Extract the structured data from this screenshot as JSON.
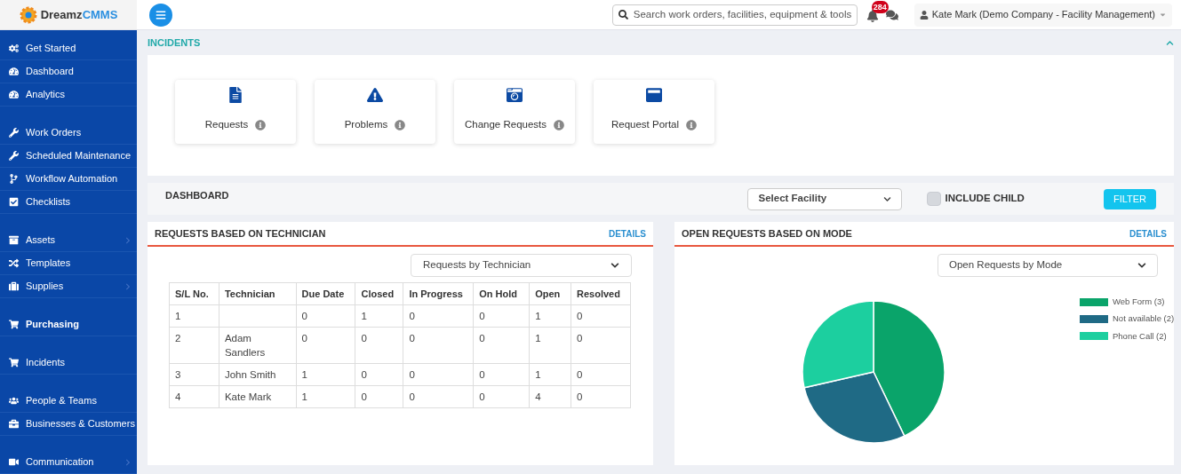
{
  "header": {
    "logo": {
      "word_1": "Dreamz",
      "word_2": "CMMS"
    },
    "search": {
      "placeholder": "Search work orders, facilities, equipment & tools"
    },
    "notifications_count": "284",
    "user": "Kate Mark (Demo Company - Facility Management)"
  },
  "sidebar": {
    "groups": [
      {
        "items": [
          {
            "label": "Get Started",
            "highlighted": false,
            "has_submenu": false
          },
          {
            "label": "Dashboard",
            "highlighted": false,
            "has_submenu": false
          },
          {
            "label": "Analytics",
            "highlighted": false,
            "has_submenu": false
          }
        ]
      },
      {
        "items": [
          {
            "label": "Work Orders",
            "highlighted": false,
            "has_submenu": false
          },
          {
            "label": "Scheduled Maintenance",
            "highlighted": false,
            "has_submenu": false
          },
          {
            "label": "Workflow Automation",
            "highlighted": false,
            "has_submenu": false
          },
          {
            "label": "Checklists",
            "highlighted": false,
            "has_submenu": false
          }
        ]
      },
      {
        "items": [
          {
            "label": "Assets",
            "highlighted": false,
            "has_submenu": true
          },
          {
            "label": "Templates",
            "highlighted": false,
            "has_submenu": false
          },
          {
            "label": "Supplies",
            "highlighted": false,
            "has_submenu": true
          }
        ]
      },
      {
        "items": [
          {
            "label": "Purchasing",
            "highlighted": true,
            "has_submenu": false
          }
        ]
      },
      {
        "items": [
          {
            "label": "Incidents",
            "highlighted": false,
            "has_submenu": false
          }
        ]
      },
      {
        "items": [
          {
            "label": "People & Teams",
            "highlighted": false,
            "has_submenu": false
          },
          {
            "label": "Businesses & Customers",
            "highlighted": false,
            "has_submenu": false
          }
        ]
      },
      {
        "items": [
          {
            "label": "Communication",
            "highlighted": false,
            "has_submenu": true
          }
        ]
      }
    ]
  },
  "section_title": "INCIDENTS",
  "cards": [
    {
      "label": "Requests"
    },
    {
      "label": "Problems"
    },
    {
      "label": "Change Requests"
    },
    {
      "label": "Request Portal"
    }
  ],
  "dashboard": {
    "title": "DASHBOARD",
    "facility_select": "Select Facility",
    "include_child": {
      "label": "INCLUDE CHILD",
      "checked": false
    },
    "filter_button": "FILTER"
  },
  "technician_panel": {
    "title": "REQUESTS BASED ON TECHNICIAN",
    "details_link": "DETAILS",
    "select": "Requests by Technician",
    "table": {
      "columns": [
        "S/L No.",
        "Technician",
        "Due Date",
        "Closed",
        "In Progress",
        "On Hold",
        "Open",
        "Resolved"
      ],
      "rows": [
        [
          "1",
          "",
          "0",
          "1",
          "0",
          "0",
          "1",
          "0"
        ],
        [
          "2",
          "Adam Sandlers",
          "0",
          "0",
          "0",
          "0",
          "1",
          "0"
        ],
        [
          "3",
          "John Smith",
          "1",
          "0",
          "0",
          "0",
          "1",
          "0"
        ],
        [
          "4",
          "Kate Mark",
          "1",
          "0",
          "0",
          "0",
          "4",
          "0"
        ]
      ]
    }
  },
  "mode_panel": {
    "title": "OPEN REQUESTS BASED ON MODE",
    "details_link": "DETAILS",
    "select": "Open Requests by Mode",
    "legend": [
      {
        "color": "#0aa46a"
      },
      {
        "color": "#1f6a85"
      },
      {
        "color": "#1ccf9f"
      }
    ],
    "chart_data": {
      "type": "pie",
      "categories": [
        "Web Form (3)",
        "Not available (2)",
        "Phone Call (2)"
      ],
      "values": [
        3,
        2,
        2
      ]
    }
  }
}
